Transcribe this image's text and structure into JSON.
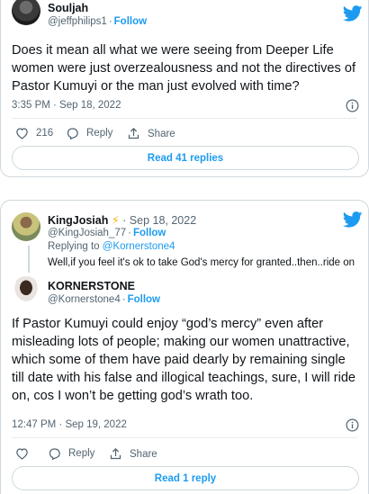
{
  "tweet1": {
    "name": "Souljah",
    "handle": "@jeffphilips1",
    "follow_label": "Follow",
    "text": "Does it mean all what we were seeing from Deeper Life women were just overzealousness and not the directives of Pastor Kumuyi or the man just evolved with time?",
    "time": "3:35 PM · Sep 18, 2022",
    "likes": "216",
    "reply_label": "Reply",
    "share_label": "Share",
    "read_label": "Read 41 replies"
  },
  "tweet2": {
    "name": "KingJosiah",
    "emoji": "⚡",
    "date": "Sep 18, 2022",
    "handle": "@KingJosiah_77",
    "follow_label": "Follow",
    "replying_prefix": "Replying to ",
    "replying_to": "@Kornerstone4",
    "text": "Well,if you feel it's ok to take God's mercy for granted..then..ride on"
  },
  "tweet3": {
    "name": "KORNERSTONE",
    "handle": "@Kornerstone4",
    "follow_label": "Follow",
    "text": "If Pastor Kumuyi could enjoy “god’s mercy” even after misleading lots of people; making our women unattractive, which some of them have paid dearly by remaining single till date with his false and illogical teachings, sure, I will ride on, cos I won’t be getting god’s wrath too.",
    "time": "12:47 PM · Sep 19, 2022",
    "reply_label": "Reply",
    "share_label": "Share",
    "read_label": "Read 1 reply"
  },
  "colors": {
    "accent": "#1d9bf0",
    "muted": "#536471",
    "border": "#cfd9de"
  }
}
